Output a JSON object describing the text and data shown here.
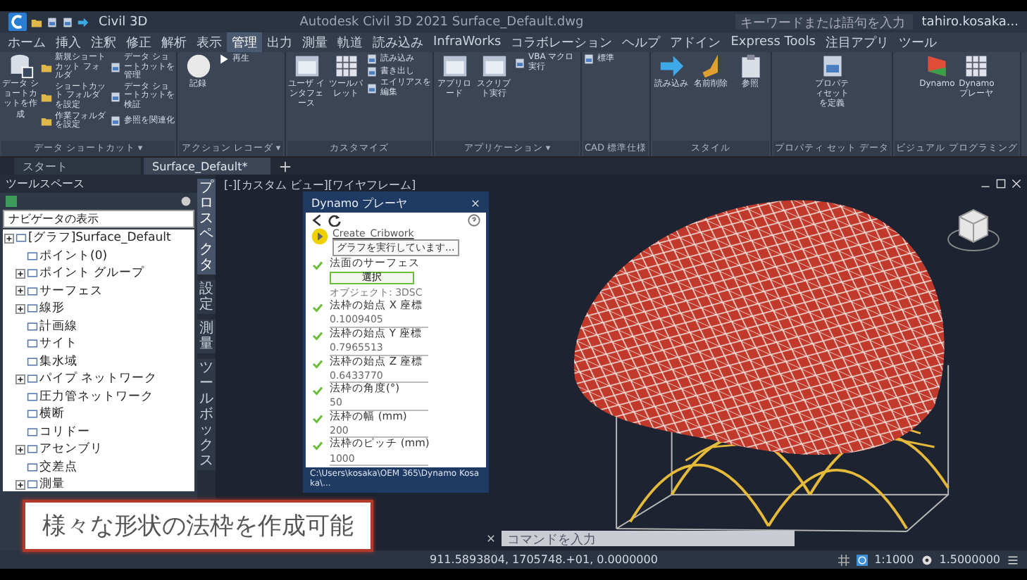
{
  "title_bar": {
    "workspace": "Civil 3D",
    "title": "Autodesk Civil 3D 2021  Surface_Default.dwg",
    "search": {
      "placeholder": "キーワードまたは語句を入力"
    },
    "user": "tahiro.kosaka..."
  },
  "menu_tabs": [
    {
      "label": "ホーム",
      "selected": false
    },
    {
      "label": "挿入",
      "selected": false
    },
    {
      "label": "注釈",
      "selected": false
    },
    {
      "label": "修正",
      "selected": false
    },
    {
      "label": "解析",
      "selected": false
    },
    {
      "label": "表示",
      "selected": false
    },
    {
      "label": "管理",
      "selected": true
    },
    {
      "label": "出力",
      "selected": false
    },
    {
      "label": "測量",
      "selected": false
    },
    {
      "label": "軌道",
      "selected": false
    },
    {
      "label": "読み込み",
      "selected": false
    },
    {
      "label": "InfraWorks",
      "selected": false
    },
    {
      "label": "コラボレーション",
      "selected": false
    },
    {
      "label": "ヘルプ",
      "selected": false
    },
    {
      "label": "アドイン",
      "selected": false
    },
    {
      "label": "Express Tools",
      "selected": false
    },
    {
      "label": "注目アプリ",
      "selected": false
    },
    {
      "label": "ツール",
      "selected": false
    }
  ],
  "ribbon": [
    {
      "title": "データ ショートカット ▾",
      "large": [
        "データ ショートカットを作成"
      ],
      "small": [
        "新規ショートカット フォルダ",
        "ショートカット フォルダを設定",
        "作業フォルダを設定",
        "データ ショートカットを管理",
        "データ ショートカットを検証",
        "参照を関連化"
      ]
    },
    {
      "title": "アクション レコーダ ▾",
      "large": [
        "記録"
      ],
      "small": [
        "再生"
      ]
    },
    {
      "title": "カスタマイズ",
      "large": [
        "ユーザ インタフェース",
        "ツールパレット"
      ],
      "small": [
        "読み込み",
        "書き出し",
        "エイリアスを編集"
      ]
    },
    {
      "title": "アプリケーション ▾",
      "large": [
        "アプリロード",
        "スクリプト実行"
      ],
      "small": [
        "VBA マクロ実行"
      ]
    },
    {
      "title": "CAD 標準仕様",
      "small": [
        "標準"
      ]
    },
    {
      "title": "スタイル",
      "large": [
        "読み込み",
        "名前削除",
        "参照"
      ]
    },
    {
      "title": "プロパティ セット データ",
      "large": [
        "プロパティセットを定義"
      ]
    },
    {
      "title": "ビジュアル プログラミング",
      "large": [
        "Dynamo",
        "Dynamo プレーヤ"
      ]
    }
  ],
  "doc_tabs": [
    {
      "label": "スタート",
      "selected": false
    },
    {
      "label": "Surface_Default*",
      "selected": true
    }
  ],
  "toolspace": {
    "title": "ツールスペース",
    "dropdown": "ナビゲータの表示",
    "tree": [
      {
        "label": "[グラフ]Surface_Default",
        "expandable": true,
        "children": [
          {
            "label": "ポイント(0)",
            "expandable": false
          },
          {
            "label": "ポイント グループ",
            "expandable": true
          },
          {
            "label": "サーフェス",
            "expandable": true
          },
          {
            "label": "線形",
            "expandable": true
          },
          {
            "label": "計画線",
            "expandable": false
          },
          {
            "label": "サイト",
            "expandable": false
          },
          {
            "label": "集水域",
            "expandable": false
          },
          {
            "label": "パイプ ネットワーク",
            "expandable": true
          },
          {
            "label": "圧力管ネットワーク",
            "expandable": false
          },
          {
            "label": "横断",
            "expandable": false
          },
          {
            "label": "コリドー",
            "expandable": false
          },
          {
            "label": "アセンブリ",
            "expandable": true
          },
          {
            "label": "交差点",
            "expandable": false
          },
          {
            "label": "測量",
            "expandable": true
          }
        ]
      }
    ]
  },
  "side_tabs": [
    {
      "label": "プロスペクタ",
      "selected": true
    },
    {
      "label": "設定",
      "selected": false
    },
    {
      "label": "測量",
      "selected": false
    },
    {
      "label": "ツールボックス",
      "selected": false
    }
  ],
  "viewport": {
    "label": "[-][カスタム ビュー][ワイヤフレーム]"
  },
  "dynamo": {
    "title": "Dynamo プレーヤ",
    "graph_name": "Create_Cribwork",
    "tooltip": "グラフを実行しています...",
    "inputs": [
      {
        "kind": "select",
        "label": "法面のサーフェス",
        "button": "選択",
        "note": "オブジェクト: 3DSC",
        "done": true
      },
      {
        "kind": "number",
        "label": "法枠の始点 X 座標",
        "value": "0.1009405",
        "done": true
      },
      {
        "kind": "number",
        "label": "法枠の始点 Y 座標",
        "value": "0.7965513",
        "done": true
      },
      {
        "kind": "number",
        "label": "法枠の始点 Z 座標",
        "value": "0.6433770",
        "done": true
      },
      {
        "kind": "number",
        "label": "法枠の角度(°)",
        "value": "50",
        "done": true
      },
      {
        "kind": "number",
        "label": "法枠の幅 (mm)",
        "value": "200",
        "done": true
      },
      {
        "kind": "number",
        "label": "法枠のピッチ (mm)",
        "value": "1000",
        "done": true
      }
    ],
    "path": "C:\\Users\\kosaka\\OEM 365\\Dynamo Kosaka\\..."
  },
  "command_line": {
    "placeholder": "コマンドを入力"
  },
  "status_bar": {
    "coordinates": "911.5893804, 1705748.+01, 0.0000000",
    "scale": "1:1000",
    "factor": "1.5000000"
  },
  "caption": "様々な形状の法枠を作成可能"
}
